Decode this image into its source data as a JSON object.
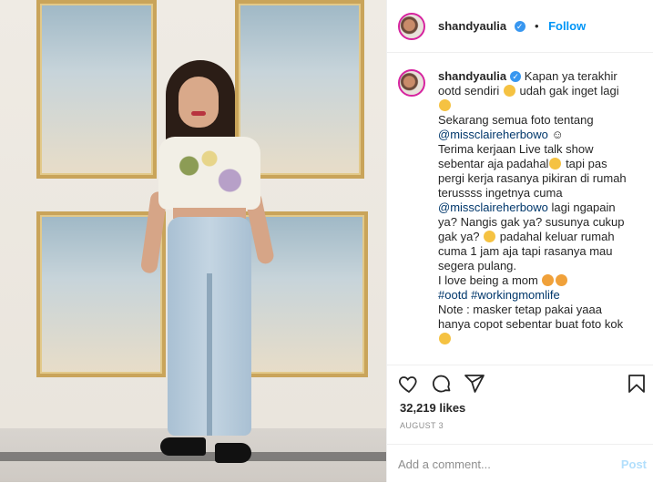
{
  "post": {
    "username": "shandyaulia",
    "verified_mark": "✓",
    "separator": "•",
    "follow_label": "Follow"
  },
  "caption": {
    "username": "shandyaulia",
    "lines": [
      "Kapan ya terakhir",
      "ootd sendiri",
      "udah gak inget lagi",
      "Sekarang semua foto tentang",
      "@missclaireherbowo",
      "Terima kerjaan Live talk show",
      "sebentar aja padahal",
      "tapi pas",
      "pergi kerja rasanya pikiran di rumah",
      "terussss ingetnya cuma",
      "@missclaireherbowo",
      "lagi ngapain",
      "ya? Nangis gak ya? susunya cukup",
      "gak ya?",
      "padahal keluar rumah",
      "cuma 1 jam aja tapi rasanya mau",
      "segera pulang.",
      "I love being a mom",
      "#ootd",
      "#workingmomlife",
      "Note : masker tetap pakai yaaa",
      "hanya copot sebentar buat foto kok"
    ],
    "small_mark": "☺"
  },
  "stats": {
    "likes": "32,219 likes",
    "date": "AUGUST 3"
  },
  "comment": {
    "placeholder": "Add a comment...",
    "post_label": "Post"
  },
  "icons": {
    "like": "heart-icon",
    "comment": "comment-icon",
    "share": "share-icon",
    "save": "bookmark-icon"
  },
  "colors": {
    "accent": "#0095f6",
    "verified": "#3897f0",
    "link": "#00376b",
    "muted": "#8e8e8e",
    "post_disabled": "#b2dffc"
  }
}
